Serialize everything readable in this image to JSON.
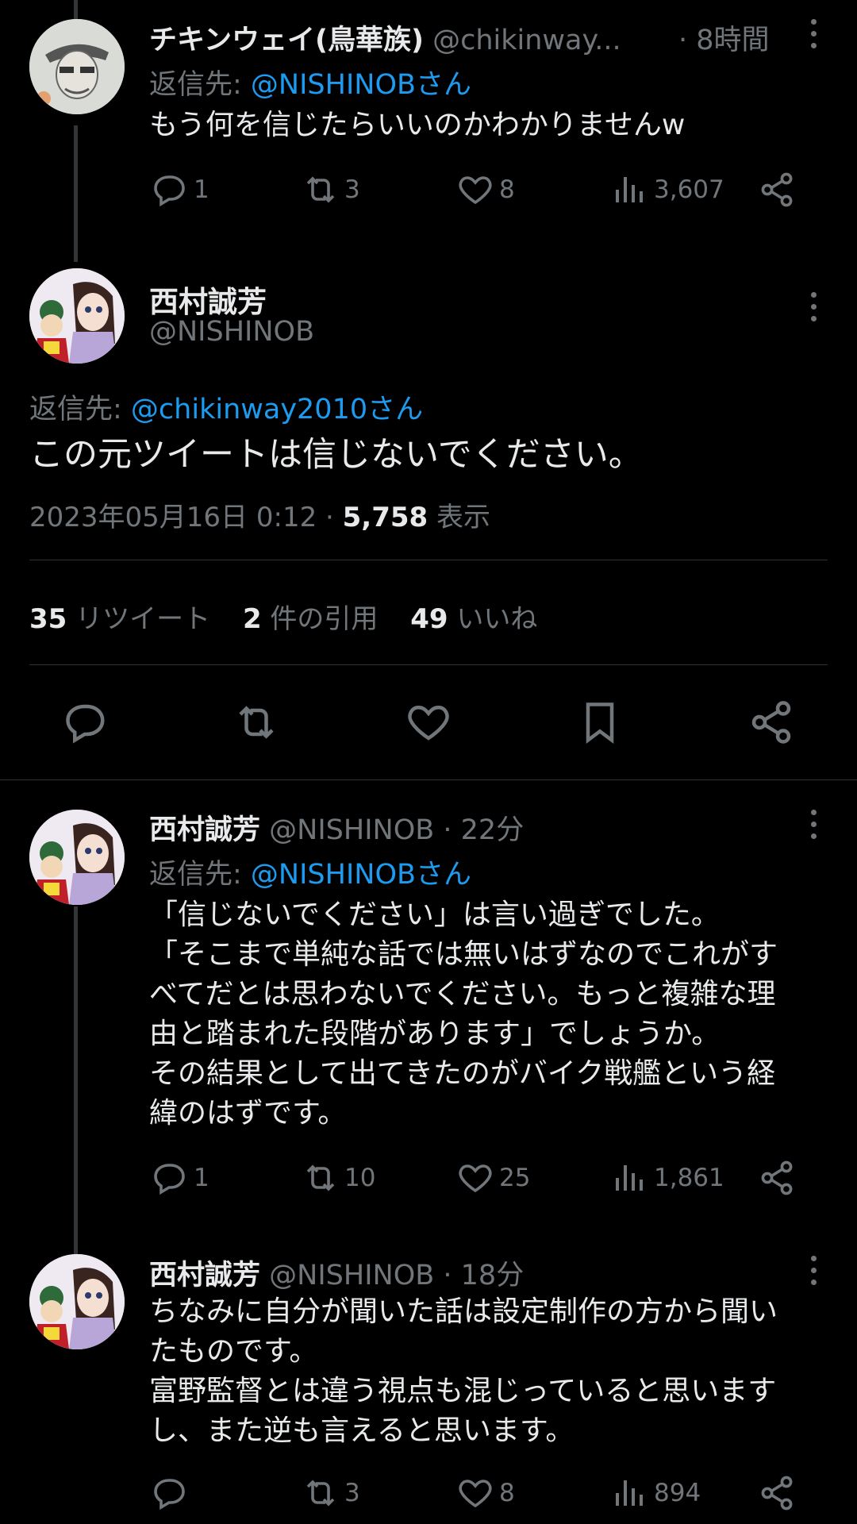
{
  "colors": {
    "background": "#000000",
    "text": "#e7e9ea",
    "muted": "#71767b",
    "link": "#1d9bf0",
    "divider": "#2f3336"
  },
  "tweet1": {
    "name": "チキンウェイ(鳥華族)",
    "handle": "@chikinway...",
    "time": "· 8時間",
    "reply_prefix": "返信先: ",
    "reply_to": "@NISHINOBさん",
    "text": "もう何を信じたらいいのかわかりませんw",
    "counts": {
      "reply": "1",
      "retweet": "3",
      "like": "8",
      "views": "3,607"
    }
  },
  "main": {
    "name": "西村誠芳",
    "handle": "@NISHINOB",
    "reply_prefix": "返信先: ",
    "reply_to": "@chikinway2010さん",
    "text": "この元ツイートは信じないでください。",
    "timestamp": "2023年05月16日 0:12 · ",
    "views_count": "5,758",
    "views_label": " 表示",
    "stats": {
      "retweets": "35",
      "retweets_label": " リツイート",
      "quotes": "2",
      "quotes_label": " 件の引用",
      "likes": "49",
      "likes_label": " いいね"
    }
  },
  "tweet3": {
    "name": "西村誠芳",
    "handle": "@NISHINOB",
    "time": "· 22分",
    "reply_prefix": "返信先: ",
    "reply_to": "@NISHINOBさん",
    "text": "「信じないでください」は言い過ぎでした。\n「そこまで単純な話では無いはずなのでこれがす\nべてだとは思わないでください。もっと複雑な理\n由と踏まれた段階があります」でしょうか。\nその結果として出てきたのがバイク戦艦という経\n緯のはずです。",
    "counts": {
      "reply": "1",
      "retweet": "10",
      "like": "25",
      "views": "1,861"
    }
  },
  "tweet4": {
    "name": "西村誠芳",
    "handle": "@NISHINOB",
    "time": "· 18分",
    "text": "ちなみに自分が聞いた話は設定制作の方から聞い\nたものです。\n富野監督とは違う視点も混じっていると思います\nし、また逆も言えると思います。",
    "counts": {
      "reply": "",
      "retweet": "3",
      "like": "8",
      "views": "894"
    }
  },
  "icons": [
    "reply-icon",
    "retweet-icon",
    "like-icon",
    "views-icon",
    "share-icon",
    "bookmark-icon",
    "more-icon"
  ]
}
